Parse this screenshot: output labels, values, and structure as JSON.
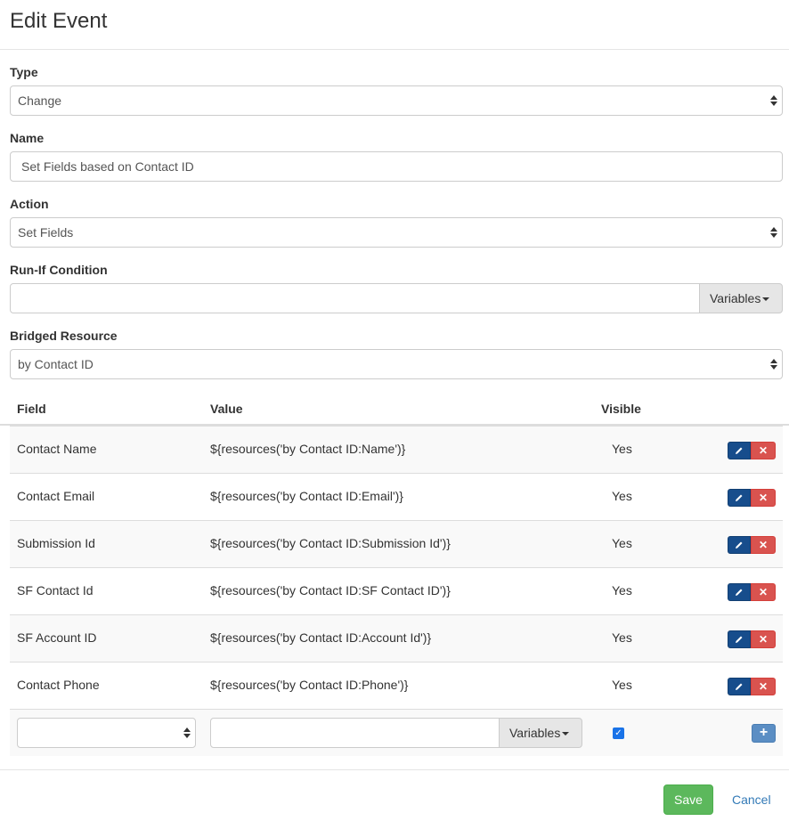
{
  "title": "Edit Event",
  "form": {
    "type_label": "Type",
    "type_value": "Change",
    "name_label": "Name",
    "name_value": "Set Fields based on Contact ID",
    "action_label": "Action",
    "action_value": "Set Fields",
    "runif_label": "Run-If Condition",
    "runif_value": "",
    "variables_label": "Variables",
    "bridged_label": "Bridged Resource",
    "bridged_value": "by Contact ID"
  },
  "table": {
    "headers": {
      "field": "Field",
      "value": "Value",
      "visible": "Visible"
    },
    "rows": [
      {
        "field": "Contact Name",
        "value": "${resources('by Contact ID:Name')}",
        "visible": "Yes"
      },
      {
        "field": "Contact Email",
        "value": "${resources('by Contact ID:Email')}",
        "visible": "Yes"
      },
      {
        "field": "Submission Id",
        "value": "${resources('by Contact ID:Submission Id')}",
        "visible": "Yes"
      },
      {
        "field": "SF Contact Id",
        "value": "${resources('by Contact ID:SF Contact ID')}",
        "visible": "Yes"
      },
      {
        "field": "SF Account ID",
        "value": "${resources('by Contact ID:Account Id')}",
        "visible": "Yes"
      },
      {
        "field": "Contact Phone",
        "value": "${resources('by Contact ID:Phone')}",
        "visible": "Yes"
      }
    ],
    "new_row": {
      "variables_label": "Variables",
      "visible_checked": true
    }
  },
  "footer": {
    "save_label": "Save",
    "cancel_label": "Cancel"
  },
  "icons": {
    "edit": "pencil-icon",
    "delete": "times-icon",
    "add": "plus-icon"
  },
  "colors": {
    "edit_button": "#174d8c",
    "delete_button": "#d9534f",
    "save_button": "#5cb85c",
    "add_button": "#5b8ec4",
    "link": "#337ab7"
  }
}
